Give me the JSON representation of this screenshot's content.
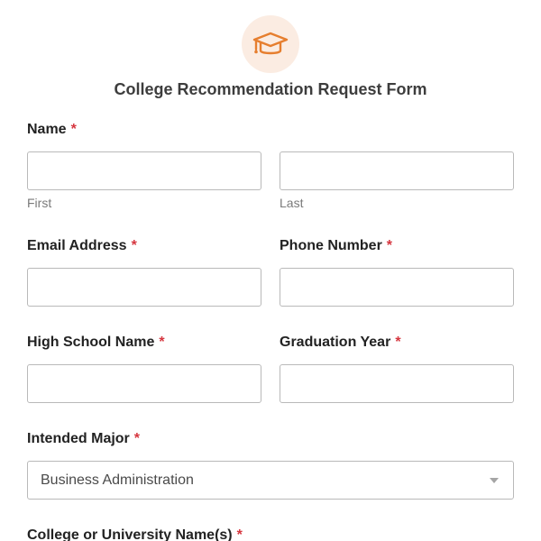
{
  "header": {
    "logo_icon": "graduation-cap-icon",
    "accent_color": "#e67e2e",
    "title": "College Recommendation Request Form"
  },
  "form": {
    "required_marker": "*",
    "name": {
      "label": "Name",
      "first_value": "",
      "last_value": "",
      "first_sublabel": "First",
      "last_sublabel": "Last"
    },
    "email": {
      "label": "Email Address",
      "value": ""
    },
    "phone": {
      "label": "Phone Number",
      "value": ""
    },
    "high_school": {
      "label": "High School Name",
      "value": ""
    },
    "graduation_year": {
      "label": "Graduation Year",
      "value": ""
    },
    "intended_major": {
      "label": "Intended Major",
      "selected": "Business Administration"
    },
    "college_names": {
      "label": "College or University Name(s)"
    }
  }
}
